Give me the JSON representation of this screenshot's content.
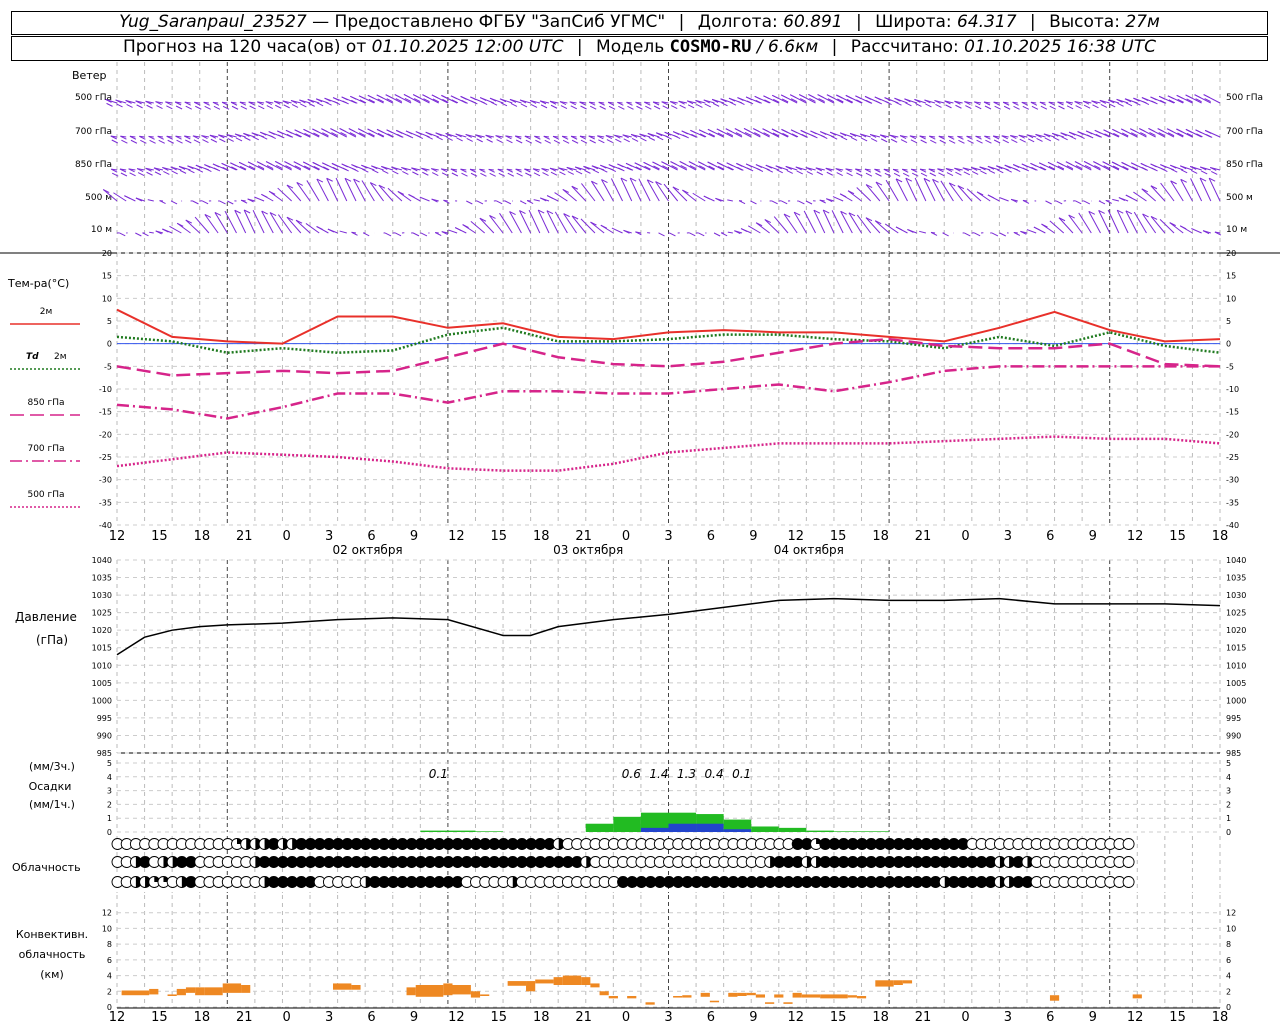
{
  "header": {
    "station": "Yug_Saranpaul_23527",
    "dash": "—",
    "provider": "Предоставлено ФГБУ \"ЗапСиб УГМС\"",
    "lon_label": "Долгота:",
    "lon_value": "60.891",
    "lat_label": "Широта:",
    "lat_value": "64.317",
    "alt_label": "Высота:",
    "alt_value": "27м",
    "forecast_prefix": "Прогноз на 120 часа(ов) от",
    "forecast_start": "01.10.2025 12:00 UTC",
    "model_label": "Модель",
    "model_name": "COSMO-RU",
    "model_res": "/ 6.6км",
    "calc_label": "Рассчитано:",
    "calc_time": "01.10.2025 16:38 UTC"
  },
  "chart_data": [
    {
      "type": "wind-barbs",
      "panel": "wind",
      "title": "Ветер",
      "levels": [
        "500 гПа",
        "700 гПа",
        "850 гПа",
        "500 м",
        "10 м"
      ],
      "color": "#7b2cd6"
    },
    {
      "type": "line",
      "panel": "temperature",
      "ylabel": "Тем-ра(°C)",
      "ylim": [
        -40,
        20
      ],
      "yticks": [
        20,
        15,
        10,
        5,
        0,
        -5,
        -10,
        -15,
        -20,
        -25,
        -30,
        -35,
        -40
      ],
      "x_hours": [
        0,
        6,
        12,
        18,
        24,
        30,
        36,
        42,
        48,
        54,
        60,
        66,
        72,
        78,
        84,
        90,
        96,
        102,
        108,
        114,
        120
      ],
      "series": [
        {
          "name": "2м",
          "color": "#e8302a",
          "dash": "solid",
          "values": [
            7.5,
            1.5,
            0.5,
            0,
            6,
            6,
            3.5,
            4.5,
            1.5,
            1,
            2.5,
            3,
            2.5,
            2.5,
            1.5,
            0.5,
            3.5,
            7,
            3,
            0.5,
            1
          ]
        },
        {
          "name": "Td 2м",
          "color": "#1f7a1f",
          "dash": "dotted",
          "values": [
            1.5,
            0.5,
            -2,
            -1,
            -2,
            -1.5,
            2,
            3.5,
            0.5,
            0.5,
            1,
            2,
            2,
            1,
            0.5,
            -1,
            1.5,
            -0.5,
            2.5,
            -0.5,
            -2
          ]
        },
        {
          "name": "850 гПа",
          "color": "#d6248a",
          "dash": "longdash",
          "values": [
            -5,
            -7,
            -6.5,
            -6,
            -6.5,
            -6,
            -3,
            0,
            -3,
            -4.5,
            -5,
            -4,
            -2,
            0,
            1,
            -0.5,
            -1,
            -1,
            0,
            -4.5,
            -5
          ]
        },
        {
          "name": "700 гПа",
          "color": "#d6248a",
          "dash": "dashdot",
          "values": [
            -13.5,
            -14.5,
            -16.5,
            -14,
            -11,
            -11,
            -13,
            -10.5,
            -10.5,
            -11,
            -11,
            -10,
            -9,
            -10.5,
            -8.5,
            -6,
            -5,
            -5,
            -5,
            -5,
            -5
          ]
        },
        {
          "name": "500 гПа",
          "color": "#d6248a",
          "dash": "dotted",
          "values": [
            -27,
            -25.5,
            -24,
            -24.5,
            -25,
            -26,
            -27.5,
            -28,
            -28,
            -26.5,
            -24,
            -23,
            -22,
            -22,
            -22,
            -21.5,
            -21,
            -20.5,
            -21,
            -21,
            -22
          ]
        }
      ],
      "zero_line_color": "#3355ee"
    },
    {
      "type": "line",
      "panel": "pressure",
      "ylabel": "Давление",
      "unit": "(гПа)",
      "ylim": [
        985,
        1040
      ],
      "yticks": [
        1040,
        1035,
        1030,
        1025,
        1020,
        1015,
        1010,
        1005,
        1000,
        995,
        990,
        985
      ],
      "x_hours": [
        0,
        3,
        6,
        9,
        12,
        18,
        24,
        30,
        36,
        42,
        45,
        48,
        54,
        60,
        66,
        72,
        78,
        84,
        90,
        96,
        102,
        108,
        114,
        120
      ],
      "values": [
        1013,
        1018,
        1020,
        1021,
        1021.5,
        1022,
        1023,
        1023.5,
        1023,
        1018.5,
        1018.5,
        1021,
        1023,
        1024.5,
        1026.5,
        1028.5,
        1029,
        1028.5,
        1028.5,
        1029,
        1027.5,
        1027.5,
        1027.5,
        1027
      ],
      "color": "#000000"
    },
    {
      "type": "bar",
      "panel": "precipitation",
      "ylabel": "(мм/3ч.)",
      "label2": "Осадки",
      "label3": "(мм/1ч.)",
      "ylim": [
        0,
        5
      ],
      "yticks": [
        5,
        4,
        3,
        2,
        1,
        0
      ],
      "x_hours": [
        33,
        36,
        39,
        51,
        54,
        57,
        60,
        63,
        66,
        69,
        72,
        75,
        78,
        81
      ],
      "values_3h": [
        0.1,
        0.1,
        0.05,
        0.6,
        1.1,
        1.4,
        1.4,
        1.3,
        0.9,
        0.4,
        0.3,
        0.1,
        0.05,
        0.05
      ],
      "values_1h": [
        0,
        0,
        0,
        0,
        0,
        0.3,
        0.6,
        0.6,
        0.2,
        0,
        0,
        0,
        0,
        0
      ],
      "annotations": [
        {
          "hour": 33,
          "text": "0.1"
        },
        {
          "hour": 54,
          "text": "0.6"
        },
        {
          "hour": 57,
          "text": "1.4"
        },
        {
          "hour": 60,
          "text": "1.3"
        },
        {
          "hour": 63,
          "text": "0.4"
        },
        {
          "hour": 66,
          "text": "0.1"
        }
      ],
      "color_3h": "#22bb22",
      "color_1h": "#2244cc"
    },
    {
      "type": "symbols",
      "panel": "cloudiness",
      "ylabel": "Облачность",
      "rows": [
        {
          "level": "high",
          "values": "0000000000000345784488888888888888888888888888886000000000000000000000000088288888888888888880000000000000000000000000000"
        },
        {
          "level": "middle",
          "values": "0048044880000004888888888888888888888888888888888884000000000000000000048884488888888888888888886484000000000000000000000000000"
        },
        {
          "level": "low",
          "values": "0045320480000000488888000004888888888800000400000000000888888888888888888888888888888888886888887588000000000000200000000000"
        }
      ],
      "symbol_note": "octas 0-8 per 1-hour step"
    },
    {
      "type": "bar",
      "panel": "convective",
      "ylabel": "Конвективн.",
      "label2": "облачность",
      "label3": "(км)",
      "ylim": [
        0,
        14
      ],
      "yticks": [
        12,
        10,
        8,
        6,
        4,
        2,
        0
      ],
      "bars": [
        {
          "from": 0.5,
          "to": 3.5,
          "bottom": 1.5,
          "top": 2.1
        },
        {
          "from": 3.5,
          "to": 4.5,
          "bottom": 1.6,
          "top": 2.3
        },
        {
          "from": 5.5,
          "to": 6.5,
          "bottom": 1.4,
          "top": 1.6
        },
        {
          "from": 6.5,
          "to": 7.5,
          "bottom": 1.5,
          "top": 2.3
        },
        {
          "from": 7.5,
          "to": 8.5,
          "bottom": 1.8,
          "top": 2.5
        },
        {
          "from": 8.5,
          "to": 9.5,
          "bottom": 1.5,
          "top": 2.5
        },
        {
          "from": 9.5,
          "to": 11.5,
          "bottom": 1.5,
          "top": 2.5
        },
        {
          "from": 11.5,
          "to": 13.5,
          "bottom": 1.8,
          "top": 3.0
        },
        {
          "from": 13.5,
          "to": 14.5,
          "bottom": 1.8,
          "top": 2.8
        },
        {
          "from": 23.5,
          "to": 25.5,
          "bottom": 2.2,
          "top": 3.0
        },
        {
          "from": 25.5,
          "to": 26.5,
          "bottom": 2.2,
          "top": 2.8
        },
        {
          "from": 31.5,
          "to": 32.5,
          "bottom": 1.5,
          "top": 2.5
        },
        {
          "from": 32.5,
          "to": 35.5,
          "bottom": 1.3,
          "top": 2.8
        },
        {
          "from": 35.5,
          "to": 36.5,
          "bottom": 1.5,
          "top": 3.0
        },
        {
          "from": 36.5,
          "to": 38.5,
          "bottom": 1.6,
          "top": 2.8
        },
        {
          "from": 38.5,
          "to": 39.5,
          "bottom": 1.2,
          "top": 2.0
        },
        {
          "from": 39.5,
          "to": 40.5,
          "bottom": 1.4,
          "top": 1.6
        },
        {
          "from": 42.5,
          "to": 44.5,
          "bottom": 2.7,
          "top": 3.3
        },
        {
          "from": 44.5,
          "to": 45.5,
          "bottom": 2.0,
          "top": 3.3
        },
        {
          "from": 45.5,
          "to": 47.5,
          "bottom": 3.0,
          "top": 3.5
        },
        {
          "from": 47.5,
          "to": 48.5,
          "bottom": 2.8,
          "top": 3.8
        },
        {
          "from": 48.5,
          "to": 50.5,
          "bottom": 2.8,
          "top": 4.0
        },
        {
          "from": 50.5,
          "to": 51.5,
          "bottom": 2.8,
          "top": 3.8
        },
        {
          "from": 51.5,
          "to": 52.5,
          "bottom": 2.5,
          "top": 3.0
        },
        {
          "from": 52.5,
          "to": 53.5,
          "bottom": 1.5,
          "top": 2.0
        },
        {
          "from": 53.5,
          "to": 54.5,
          "bottom": 1.1,
          "top": 1.4
        },
        {
          "from": 55.5,
          "to": 56.5,
          "bottom": 1.1,
          "top": 1.4
        },
        {
          "from": 57.5,
          "to": 58.5,
          "bottom": 0.3,
          "top": 0.6
        },
        {
          "from": 60.5,
          "to": 61.5,
          "bottom": 1.2,
          "top": 1.4
        },
        {
          "from": 61.5,
          "to": 62.5,
          "bottom": 1.2,
          "top": 1.5
        },
        {
          "from": 63.5,
          "to": 64.5,
          "bottom": 1.3,
          "top": 1.8
        },
        {
          "from": 64.5,
          "to": 65.5,
          "bottom": 0.6,
          "top": 0.8
        },
        {
          "from": 66.5,
          "to": 67.5,
          "bottom": 1.3,
          "top": 1.8
        },
        {
          "from": 67.5,
          "to": 68.5,
          "bottom": 1.4,
          "top": 1.8
        },
        {
          "from": 68.5,
          "to": 69.5,
          "bottom": 1.5,
          "top": 1.8
        },
        {
          "from": 69.5,
          "to": 70.5,
          "bottom": 1.2,
          "top": 1.6
        },
        {
          "from": 70.5,
          "to": 71.5,
          "bottom": 0.4,
          "top": 0.6
        },
        {
          "from": 71.5,
          "to": 72.5,
          "bottom": 1.2,
          "top": 1.6
        },
        {
          "from": 72.5,
          "to": 73.5,
          "bottom": 0.4,
          "top": 0.6
        },
        {
          "from": 73.5,
          "to": 74.5,
          "bottom": 1.2,
          "top": 1.8
        },
        {
          "from": 74.5,
          "to": 76.5,
          "bottom": 1.2,
          "top": 1.6
        },
        {
          "from": 76.5,
          "to": 79.5,
          "bottom": 1.1,
          "top": 1.6
        },
        {
          "from": 79.5,
          "to": 80.5,
          "bottom": 1.2,
          "top": 1.5
        },
        {
          "from": 80.5,
          "to": 81.5,
          "bottom": 1.1,
          "top": 1.4
        },
        {
          "from": 82.5,
          "to": 84.5,
          "bottom": 2.6,
          "top": 3.4
        },
        {
          "from": 84.5,
          "to": 85.5,
          "bottom": 2.8,
          "top": 3.4
        },
        {
          "from": 85.5,
          "to": 86.5,
          "bottom": 3.0,
          "top": 3.4
        },
        {
          "from": 101.5,
          "to": 102.5,
          "bottom": 0.8,
          "top": 1.5
        },
        {
          "from": 110.5,
          "to": 111.5,
          "bottom": 1.1,
          "top": 1.6
        }
      ],
      "color": "#ee8822"
    }
  ],
  "time_axis": {
    "hours_labels": [
      "12",
      "15",
      "18",
      "21",
      "0",
      "3",
      "6",
      "9",
      "12",
      "15",
      "18",
      "21",
      "0",
      "3",
      "6",
      "9",
      "12",
      "15",
      "18",
      "21",
      "0",
      "3",
      "6",
      "9",
      "12",
      "15",
      "18"
    ],
    "dates": [
      {
        "hour": 24,
        "text": "02 октября"
      },
      {
        "hour": 48,
        "text": "03 октября"
      },
      {
        "hour": 72,
        "text": "04 октября"
      }
    ]
  },
  "legend": {
    "temp_title": "Тем-ра(°C)",
    "t2m": "2м",
    "td": "Td",
    "td2m": "2м",
    "p850": "850 гПа",
    "p700": "700 гПа",
    "p500": "500 гПа"
  }
}
